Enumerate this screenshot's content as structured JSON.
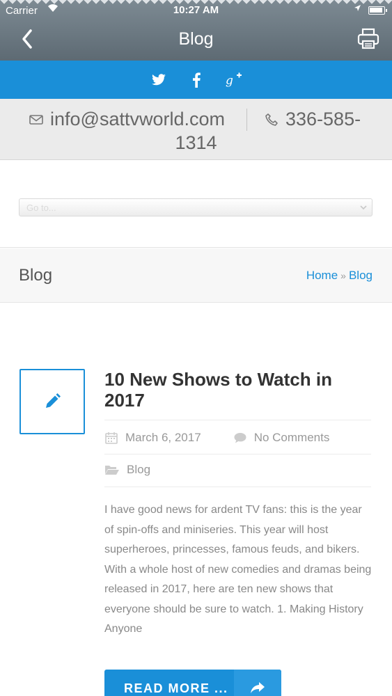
{
  "status_bar": {
    "carrier": "Carrier",
    "time": "10:27 AM"
  },
  "nav": {
    "title": "Blog",
    "back_icon": "chevron-left-icon",
    "print_icon": "printer-icon"
  },
  "social": {
    "items": [
      {
        "name": "twitter",
        "icon": "twitter-icon"
      },
      {
        "name": "facebook",
        "icon": "facebook-icon"
      },
      {
        "name": "google-plus",
        "icon": "google-plus-icon"
      }
    ]
  },
  "contact": {
    "email": "info@sattvworld.com",
    "phone_line1": "336-585-",
    "phone_line2": "1314"
  },
  "goto_select": {
    "placeholder": "Go to..."
  },
  "page_heading": {
    "title": "Blog",
    "breadcrumb": [
      "Home",
      "Blog"
    ],
    "breadcrumb_separator": "»"
  },
  "post": {
    "title": "10 New Shows to Watch in 2017",
    "date": "March 6, 2017",
    "comments": "No Comments",
    "category": "Blog",
    "excerpt": "I have good news for ardent TV fans: this is the year of spin-offs and miniseries. This year will host superheroes, princesses, famous feuds, and bikers. With a whole host of new comedies and dramas being released in 2017, here are ten new shows that everyone should be sure to watch. 1. Making History Anyone",
    "read_more_label": "READ MORE ..."
  },
  "colors": {
    "accent": "#1a8fd8",
    "header_bg": "#6b7780",
    "contact_bg": "#ebebeb"
  }
}
